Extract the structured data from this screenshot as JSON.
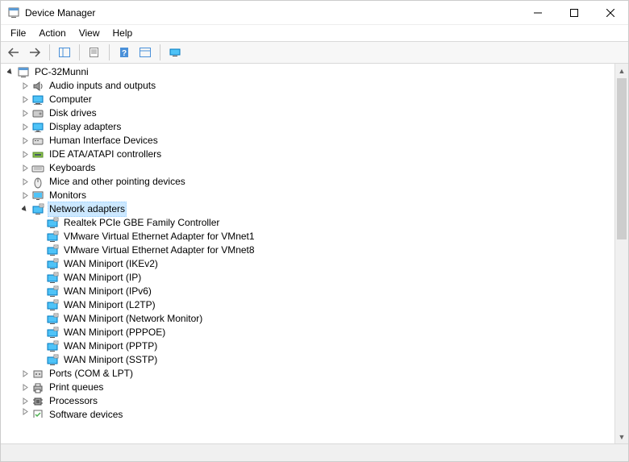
{
  "window": {
    "title": "Device Manager"
  },
  "menubar": {
    "file": "File",
    "action": "Action",
    "view": "View",
    "help": "Help"
  },
  "tree": {
    "root": {
      "label": "PC-32Munni",
      "expanded": true
    },
    "categories": [
      {
        "label": "Audio inputs and outputs",
        "icon": "speaker",
        "children": []
      },
      {
        "label": "Computer",
        "icon": "computer",
        "children": []
      },
      {
        "label": "Disk drives",
        "icon": "disk",
        "children": []
      },
      {
        "label": "Display adapters",
        "icon": "display",
        "children": []
      },
      {
        "label": "Human Interface Devices",
        "icon": "hid",
        "children": []
      },
      {
        "label": "IDE ATA/ATAPI controllers",
        "icon": "ide",
        "children": []
      },
      {
        "label": "Keyboards",
        "icon": "keyboard",
        "children": []
      },
      {
        "label": "Mice and other pointing devices",
        "icon": "mouse",
        "children": []
      },
      {
        "label": "Monitors",
        "icon": "monitor",
        "children": []
      },
      {
        "label": "Network adapters",
        "icon": "network",
        "expanded": true,
        "selected": true,
        "children": [
          {
            "label": "Realtek PCIe GBE Family Controller",
            "icon": "network"
          },
          {
            "label": "VMware Virtual Ethernet Adapter for VMnet1",
            "icon": "network"
          },
          {
            "label": "VMware Virtual Ethernet Adapter for VMnet8",
            "icon": "network"
          },
          {
            "label": "WAN Miniport (IKEv2)",
            "icon": "network"
          },
          {
            "label": "WAN Miniport (IP)",
            "icon": "network"
          },
          {
            "label": "WAN Miniport (IPv6)",
            "icon": "network"
          },
          {
            "label": "WAN Miniport (L2TP)",
            "icon": "network"
          },
          {
            "label": "WAN Miniport (Network Monitor)",
            "icon": "network"
          },
          {
            "label": "WAN Miniport (PPPOE)",
            "icon": "network"
          },
          {
            "label": "WAN Miniport (PPTP)",
            "icon": "network"
          },
          {
            "label": "WAN Miniport (SSTP)",
            "icon": "network"
          }
        ]
      },
      {
        "label": "Ports (COM & LPT)",
        "icon": "port",
        "children": []
      },
      {
        "label": "Print queues",
        "icon": "printer",
        "children": []
      },
      {
        "label": "Processors",
        "icon": "cpu",
        "children": []
      },
      {
        "label": "Software devices",
        "icon": "software",
        "children": [],
        "cut": true
      }
    ]
  }
}
